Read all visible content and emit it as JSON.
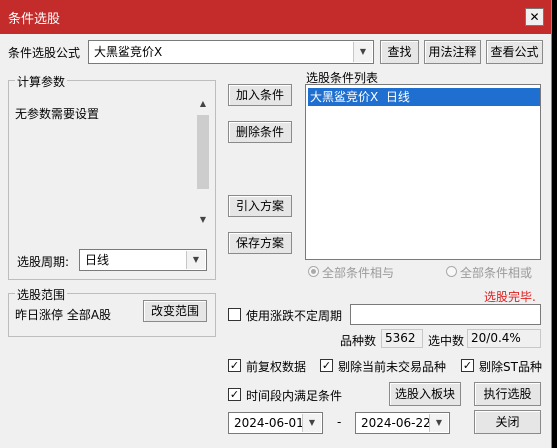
{
  "window": {
    "title": "条件选股",
    "close_symbol": "✕"
  },
  "formula": {
    "label": "条件选股公式",
    "value": "大黑鲨竞价X",
    "find_button": "查找",
    "usage_button": "用法注释",
    "view_button": "查看公式"
  },
  "params": {
    "title": "计算参数",
    "text": "无参数需要设置"
  },
  "period": {
    "label": "选股周期:",
    "value": "日线"
  },
  "middle_buttons": {
    "add": "加入条件",
    "delete": "删除条件",
    "import": "引入方案",
    "save": "保存方案"
  },
  "condlist": {
    "title": "选股条件列表",
    "items": [
      "大黑鲨竞价X  日线"
    ]
  },
  "logic": {
    "and_label": "全部条件相与",
    "or_label": "全部条件相或",
    "selected": "and"
  },
  "status": {
    "text": "选股完毕.",
    "color": "#e02020"
  },
  "range": {
    "title": "选股范围",
    "value": "昨日涨停 全部A股",
    "change_button": "改变范围"
  },
  "uncertain_period": {
    "label": "使用涨跌不定周期",
    "checked": false,
    "value": ""
  },
  "stats": {
    "count_label": "品种数",
    "count_value": "5362",
    "hit_label": "选中数",
    "hit_value": "20/0.4%"
  },
  "options": {
    "prerights": {
      "label": "前复权数据",
      "checked": true
    },
    "exclude_untraded": {
      "label": "剔除当前未交易品种",
      "checked": true
    },
    "exclude_st": {
      "label": "剔除ST品种",
      "checked": true
    }
  },
  "time_range": {
    "label": "时间段内满足条件",
    "checked": true,
    "start": "2024-06-01",
    "separator": "-",
    "end": "2024-06-22"
  },
  "actions": {
    "to_block": "选股入板块",
    "execute": "执行选股",
    "close": "关闭"
  }
}
